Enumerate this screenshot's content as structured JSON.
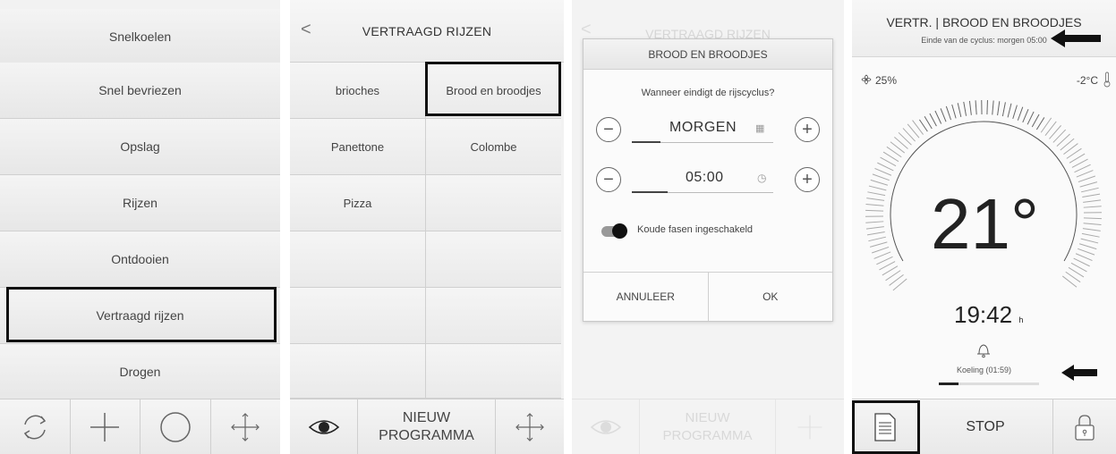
{
  "screen1": {
    "menu": [
      "Snelkoelen",
      "Snel bevriezen",
      "Opslag",
      "Rijzen",
      "Ontdooien",
      "Vertraagd rijzen",
      "Drogen"
    ],
    "toolbar_icons": [
      "refresh-icon",
      "plus-icon",
      "circle-icon",
      "move-icon"
    ]
  },
  "screen2": {
    "title": "VERTRAAGD RIJZEN",
    "back": "<",
    "programs": [
      "brioches",
      "Brood en broodjes",
      "Panettone",
      "Colombe",
      "Pizza"
    ],
    "new_program_line1": "NIEUW",
    "new_program_line2": "PROGRAMMA",
    "toolbar_icons": [
      "eye-icon",
      "move-icon"
    ]
  },
  "screen3": {
    "ghost_title": "VERTRAAGD RIJZEN",
    "ghost_new_line1": "NIEUW",
    "ghost_new_line2": "PROGRAMMA",
    "dialog": {
      "title": "BROOD EN BROODJES",
      "question": "Wanneer eindigt de rijscyclus?",
      "day_value": "MORGEN",
      "time_value": "05:00",
      "toggle_label": "Koude fasen ingeschakeld",
      "cancel": "ANNULEER",
      "ok": "OK"
    }
  },
  "screen4": {
    "title": "VERTR. | BROOD EN BROODJES",
    "subtitle": "Einde van de cyclus: morgen 05:00",
    "fan_percent": "25%",
    "outside_temp": "-2°C",
    "temperature": "21°",
    "time": "19:42",
    "time_unit": "h",
    "cooling": "Koeling (01:59)",
    "stop": "STOP"
  }
}
